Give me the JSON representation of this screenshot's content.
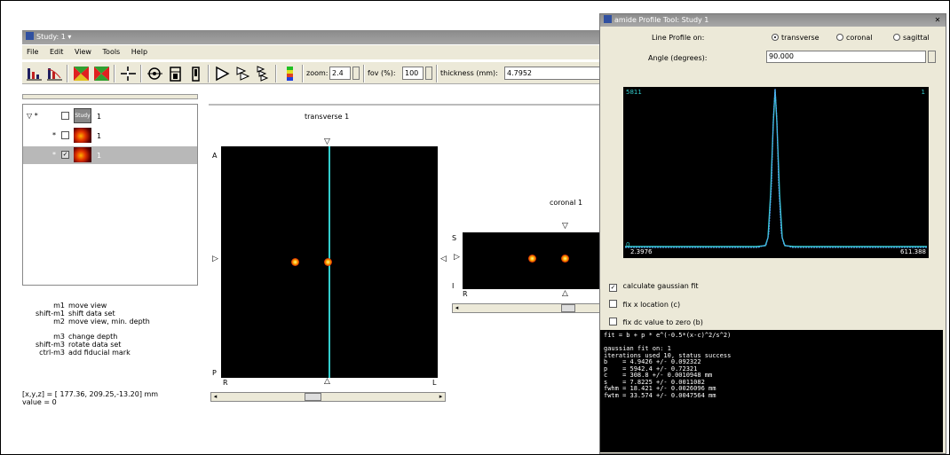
{
  "main_window": {
    "title": "Study: 1 ▾",
    "menu": [
      "File",
      "Edit",
      "View",
      "Tools",
      "Help"
    ],
    "toolbar": {
      "zoom_label": "zoom:",
      "zoom_value": "2.4",
      "fov_label": "fov (%):",
      "fov_value": "100",
      "thickness_label": "thickness (mm):",
      "thickness_value": "4.7952"
    },
    "tree": {
      "items": [
        {
          "prefix": "▽ *",
          "label": "1",
          "thumb_text": "Study"
        },
        {
          "prefix": "*",
          "label": "1"
        },
        {
          "prefix": "*",
          "label": "1"
        }
      ]
    },
    "hints": [
      {
        "key": "m1",
        "text": "move view"
      },
      {
        "key": "shift-m1",
        "text": "shift data set"
      },
      {
        "key": "m2",
        "text": "move view, min. depth"
      },
      {
        "key": "m3",
        "text": "change depth"
      },
      {
        "key": "shift-m3",
        "text": "rotate data set"
      },
      {
        "key": "ctrl-m3",
        "text": "add fiducial mark"
      }
    ],
    "coords_label": "[x,y,z] = [ 177.36, 209.25,-13.20] mm",
    "value_label": "value  =    0",
    "transverse_view": {
      "title": "transverse 1",
      "label_A": "A",
      "label_P": "P",
      "label_R": "R",
      "label_L": "L"
    },
    "coronal_view": {
      "title": "coronal 1",
      "label_S": "S",
      "label_I": "I",
      "label_R": "R"
    }
  },
  "profile_tool": {
    "title": "amide Profile Tool: Study 1",
    "line_profile_label": "Line Profile on:",
    "orientations": [
      "transverse",
      "coronal",
      "sagittal"
    ],
    "selected_orientation": "transverse",
    "angle_label": "Angle (degrees):",
    "angle_value": "90.000",
    "plot": {
      "ymax_label": "5811",
      "top_right_label": "1",
      "ymin_label": "0",
      "xmin_label": "2.3976",
      "xmax_label": "611.388"
    },
    "options": [
      {
        "label": "calculate gaussian fit",
        "checked": true
      },
      {
        "label": "fix x location (c)",
        "checked": false
      },
      {
        "label": "fix dc value to zero (b)",
        "checked": false
      }
    ],
    "fit_lines": [
      "fit = b + p * e^(-0.5*(x-c)^2/s^2)",
      "",
      "gaussian fit on: 1",
      "iterations used 10, status success",
      "b    = 4.9426 +/- 0.092322",
      "p    = 5942.4 +/- 0.72321",
      "c    = 308.8 +/- 0.0010948 mm",
      "s    = 7.8225 +/- 0.0011082",
      "fwhm = 18.421 +/- 0.0026096 mm",
      "fwtm = 33.574 +/- 0.0047564 mm"
    ]
  },
  "colors": {
    "profile_line": "#33cccc",
    "titlebar": "#9a9a9a",
    "hotspot": "#ff9a00"
  }
}
